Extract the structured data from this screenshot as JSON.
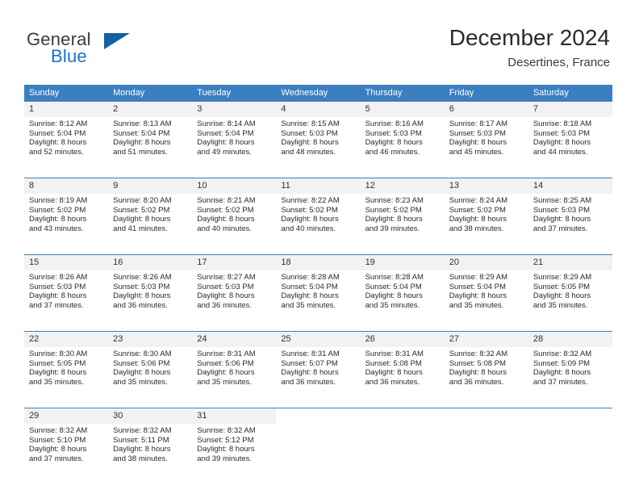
{
  "brand": {
    "word1": "General",
    "word2": "Blue",
    "logo_icon": "triangle-icon"
  },
  "header": {
    "title": "December 2024",
    "subtitle": "Desertines, France"
  },
  "colors": {
    "header_blue": "#3c7fc1",
    "brand_blue": "#1675c0",
    "daynum_band": "#f2f2f2"
  },
  "calendar": {
    "weekday_headers": [
      "Sunday",
      "Monday",
      "Tuesday",
      "Wednesday",
      "Thursday",
      "Friday",
      "Saturday"
    ],
    "weeks": [
      [
        {
          "day": "1",
          "sunrise": "Sunrise: 8:12 AM",
          "sunset": "Sunset: 5:04 PM",
          "daylight1": "Daylight: 8 hours",
          "daylight2": "and 52 minutes."
        },
        {
          "day": "2",
          "sunrise": "Sunrise: 8:13 AM",
          "sunset": "Sunset: 5:04 PM",
          "daylight1": "Daylight: 8 hours",
          "daylight2": "and 51 minutes."
        },
        {
          "day": "3",
          "sunrise": "Sunrise: 8:14 AM",
          "sunset": "Sunset: 5:04 PM",
          "daylight1": "Daylight: 8 hours",
          "daylight2": "and 49 minutes."
        },
        {
          "day": "4",
          "sunrise": "Sunrise: 8:15 AM",
          "sunset": "Sunset: 5:03 PM",
          "daylight1": "Daylight: 8 hours",
          "daylight2": "and 48 minutes."
        },
        {
          "day": "5",
          "sunrise": "Sunrise: 8:16 AM",
          "sunset": "Sunset: 5:03 PM",
          "daylight1": "Daylight: 8 hours",
          "daylight2": "and 46 minutes."
        },
        {
          "day": "6",
          "sunrise": "Sunrise: 8:17 AM",
          "sunset": "Sunset: 5:03 PM",
          "daylight1": "Daylight: 8 hours",
          "daylight2": "and 45 minutes."
        },
        {
          "day": "7",
          "sunrise": "Sunrise: 8:18 AM",
          "sunset": "Sunset: 5:03 PM",
          "daylight1": "Daylight: 8 hours",
          "daylight2": "and 44 minutes."
        }
      ],
      [
        {
          "day": "8",
          "sunrise": "Sunrise: 8:19 AM",
          "sunset": "Sunset: 5:02 PM",
          "daylight1": "Daylight: 8 hours",
          "daylight2": "and 43 minutes."
        },
        {
          "day": "9",
          "sunrise": "Sunrise: 8:20 AM",
          "sunset": "Sunset: 5:02 PM",
          "daylight1": "Daylight: 8 hours",
          "daylight2": "and 41 minutes."
        },
        {
          "day": "10",
          "sunrise": "Sunrise: 8:21 AM",
          "sunset": "Sunset: 5:02 PM",
          "daylight1": "Daylight: 8 hours",
          "daylight2": "and 40 minutes."
        },
        {
          "day": "11",
          "sunrise": "Sunrise: 8:22 AM",
          "sunset": "Sunset: 5:02 PM",
          "daylight1": "Daylight: 8 hours",
          "daylight2": "and 40 minutes."
        },
        {
          "day": "12",
          "sunrise": "Sunrise: 8:23 AM",
          "sunset": "Sunset: 5:02 PM",
          "daylight1": "Daylight: 8 hours",
          "daylight2": "and 39 minutes."
        },
        {
          "day": "13",
          "sunrise": "Sunrise: 8:24 AM",
          "sunset": "Sunset: 5:02 PM",
          "daylight1": "Daylight: 8 hours",
          "daylight2": "and 38 minutes."
        },
        {
          "day": "14",
          "sunrise": "Sunrise: 8:25 AM",
          "sunset": "Sunset: 5:03 PM",
          "daylight1": "Daylight: 8 hours",
          "daylight2": "and 37 minutes."
        }
      ],
      [
        {
          "day": "15",
          "sunrise": "Sunrise: 8:26 AM",
          "sunset": "Sunset: 5:03 PM",
          "daylight1": "Daylight: 8 hours",
          "daylight2": "and 37 minutes."
        },
        {
          "day": "16",
          "sunrise": "Sunrise: 8:26 AM",
          "sunset": "Sunset: 5:03 PM",
          "daylight1": "Daylight: 8 hours",
          "daylight2": "and 36 minutes."
        },
        {
          "day": "17",
          "sunrise": "Sunrise: 8:27 AM",
          "sunset": "Sunset: 5:03 PM",
          "daylight1": "Daylight: 8 hours",
          "daylight2": "and 36 minutes."
        },
        {
          "day": "18",
          "sunrise": "Sunrise: 8:28 AM",
          "sunset": "Sunset: 5:04 PM",
          "daylight1": "Daylight: 8 hours",
          "daylight2": "and 35 minutes."
        },
        {
          "day": "19",
          "sunrise": "Sunrise: 8:28 AM",
          "sunset": "Sunset: 5:04 PM",
          "daylight1": "Daylight: 8 hours",
          "daylight2": "and 35 minutes."
        },
        {
          "day": "20",
          "sunrise": "Sunrise: 8:29 AM",
          "sunset": "Sunset: 5:04 PM",
          "daylight1": "Daylight: 8 hours",
          "daylight2": "and 35 minutes."
        },
        {
          "day": "21",
          "sunrise": "Sunrise: 8:29 AM",
          "sunset": "Sunset: 5:05 PM",
          "daylight1": "Daylight: 8 hours",
          "daylight2": "and 35 minutes."
        }
      ],
      [
        {
          "day": "22",
          "sunrise": "Sunrise: 8:30 AM",
          "sunset": "Sunset: 5:05 PM",
          "daylight1": "Daylight: 8 hours",
          "daylight2": "and 35 minutes."
        },
        {
          "day": "23",
          "sunrise": "Sunrise: 8:30 AM",
          "sunset": "Sunset: 5:06 PM",
          "daylight1": "Daylight: 8 hours",
          "daylight2": "and 35 minutes."
        },
        {
          "day": "24",
          "sunrise": "Sunrise: 8:31 AM",
          "sunset": "Sunset: 5:06 PM",
          "daylight1": "Daylight: 8 hours",
          "daylight2": "and 35 minutes."
        },
        {
          "day": "25",
          "sunrise": "Sunrise: 8:31 AM",
          "sunset": "Sunset: 5:07 PM",
          "daylight1": "Daylight: 8 hours",
          "daylight2": "and 36 minutes."
        },
        {
          "day": "26",
          "sunrise": "Sunrise: 8:31 AM",
          "sunset": "Sunset: 5:08 PM",
          "daylight1": "Daylight: 8 hours",
          "daylight2": "and 36 minutes."
        },
        {
          "day": "27",
          "sunrise": "Sunrise: 8:32 AM",
          "sunset": "Sunset: 5:08 PM",
          "daylight1": "Daylight: 8 hours",
          "daylight2": "and 36 minutes."
        },
        {
          "day": "28",
          "sunrise": "Sunrise: 8:32 AM",
          "sunset": "Sunset: 5:09 PM",
          "daylight1": "Daylight: 8 hours",
          "daylight2": "and 37 minutes."
        }
      ],
      [
        {
          "day": "29",
          "sunrise": "Sunrise: 8:32 AM",
          "sunset": "Sunset: 5:10 PM",
          "daylight1": "Daylight: 8 hours",
          "daylight2": "and 37 minutes."
        },
        {
          "day": "30",
          "sunrise": "Sunrise: 8:32 AM",
          "sunset": "Sunset: 5:11 PM",
          "daylight1": "Daylight: 8 hours",
          "daylight2": "and 38 minutes."
        },
        {
          "day": "31",
          "sunrise": "Sunrise: 8:32 AM",
          "sunset": "Sunset: 5:12 PM",
          "daylight1": "Daylight: 8 hours",
          "daylight2": "and 39 minutes."
        },
        {
          "day": "",
          "sunrise": "",
          "sunset": "",
          "daylight1": "",
          "daylight2": ""
        },
        {
          "day": "",
          "sunrise": "",
          "sunset": "",
          "daylight1": "",
          "daylight2": ""
        },
        {
          "day": "",
          "sunrise": "",
          "sunset": "",
          "daylight1": "",
          "daylight2": ""
        },
        {
          "day": "",
          "sunrise": "",
          "sunset": "",
          "daylight1": "",
          "daylight2": ""
        }
      ]
    ]
  }
}
